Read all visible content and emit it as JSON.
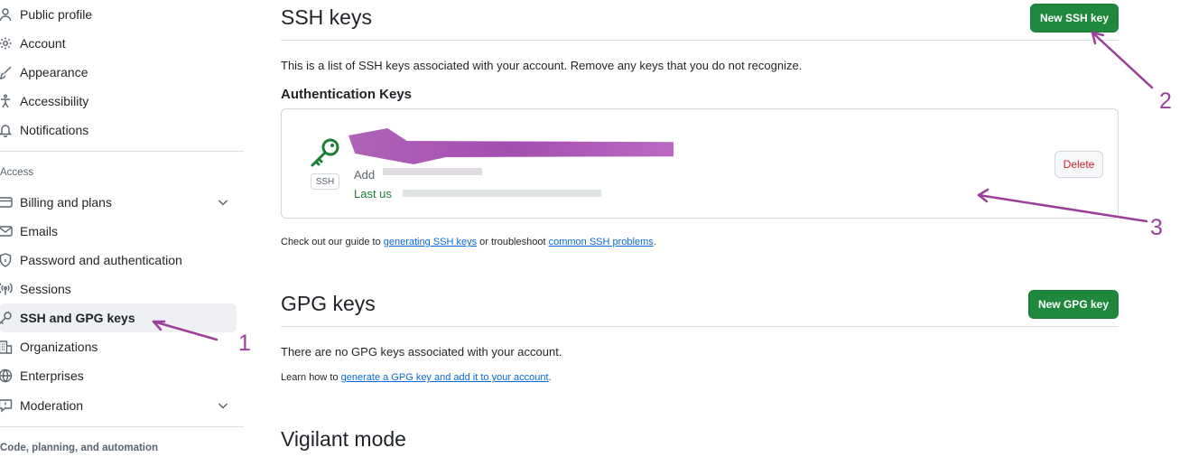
{
  "sidebar": {
    "items": [
      {
        "label": "Public profile",
        "icon": "person-icon"
      },
      {
        "label": "Account",
        "icon": "gear-icon"
      },
      {
        "label": "Appearance",
        "icon": "paintbrush-icon"
      },
      {
        "label": "Accessibility",
        "icon": "accessibility-icon"
      },
      {
        "label": "Notifications",
        "icon": "bell-icon"
      }
    ],
    "access_heading": "Access",
    "access_items": [
      {
        "label": "Billing and plans",
        "icon": "credit-card-icon"
      },
      {
        "label": "Emails",
        "icon": "mail-icon"
      },
      {
        "label": "Password and authentication",
        "icon": "shield-lock-icon"
      },
      {
        "label": "Sessions",
        "icon": "broadcast-icon"
      },
      {
        "label": "SSH and GPG keys",
        "icon": "key-icon"
      },
      {
        "label": "Organizations",
        "icon": "organization-icon"
      },
      {
        "label": "Enterprises",
        "icon": "globe-icon"
      },
      {
        "label": "Moderation",
        "icon": "report-icon"
      }
    ],
    "code_heading": "Code, planning, and automation"
  },
  "ssh": {
    "title": "SSH keys",
    "new_button": "New SSH key",
    "description": "This is a list of SSH keys associated with your account. Remove any keys that you do not recognize.",
    "auth_heading": "Authentication Keys",
    "key": {
      "type_label": "SSH",
      "added_prefix": "Add",
      "last_used_prefix": "Last us",
      "delete_label": "Delete"
    },
    "guide_prefix": "Check out our guide to ",
    "guide_link": "generating SSH keys",
    "guide_middle": " or troubleshoot ",
    "troubleshoot_link": "common SSH problems",
    "guide_suffix": "."
  },
  "gpg": {
    "title": "GPG keys",
    "new_button": "New GPG key",
    "empty_text": "There are no GPG keys associated with your account.",
    "learn_prefix": "Learn how to ",
    "learn_link": "generate a GPG key and add it to your account",
    "learn_suffix": "."
  },
  "vigilant": {
    "title": "Vigilant mode"
  },
  "annotations": {
    "one": "1",
    "two": "2",
    "three": "3"
  },
  "colors": {
    "green": "#1f883d",
    "link": "#0969da",
    "danger": "#cf222e",
    "annotation": "#9b3f9b",
    "key_green": "#1a7f37"
  }
}
